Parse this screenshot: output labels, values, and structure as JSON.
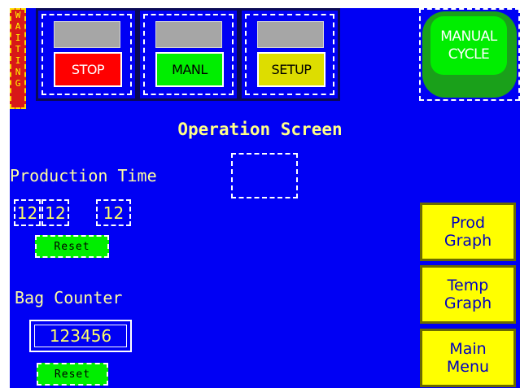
{
  "status": {
    "waiting_letters": [
      "W",
      "A",
      "I",
      "T",
      "I",
      "N",
      "G"
    ],
    "waiting_color": "#d81818"
  },
  "mode_buttons": [
    {
      "label": "STOP",
      "color": "#ff0000",
      "text_color": "#ffffff"
    },
    {
      "label": "MANL",
      "color": "#00ee00",
      "text_color": "#000000"
    },
    {
      "label": "SETUP",
      "color": "#dddd00",
      "text_color": "#000000"
    }
  ],
  "manual_cycle": {
    "line1": "MANUAL",
    "line2": "CYCLE"
  },
  "title": "Operation Screen",
  "production_time": {
    "label": "Production Time",
    "hours": "12",
    "minutes": "12",
    "seconds": "12",
    "reset_label": "Reset"
  },
  "bag_counter": {
    "label": "Bag Counter",
    "value": "123456",
    "reset_label": "Reset"
  },
  "side_buttons": [
    {
      "line1": "Prod",
      "line2": "Graph"
    },
    {
      "line1": "Temp",
      "line2": "Graph"
    },
    {
      "line1": "Main",
      "line2": "Menu"
    }
  ],
  "colors": {
    "background": "#0000f4",
    "accent_yellow": "#ffff00",
    "reset_green": "#00ee00"
  }
}
